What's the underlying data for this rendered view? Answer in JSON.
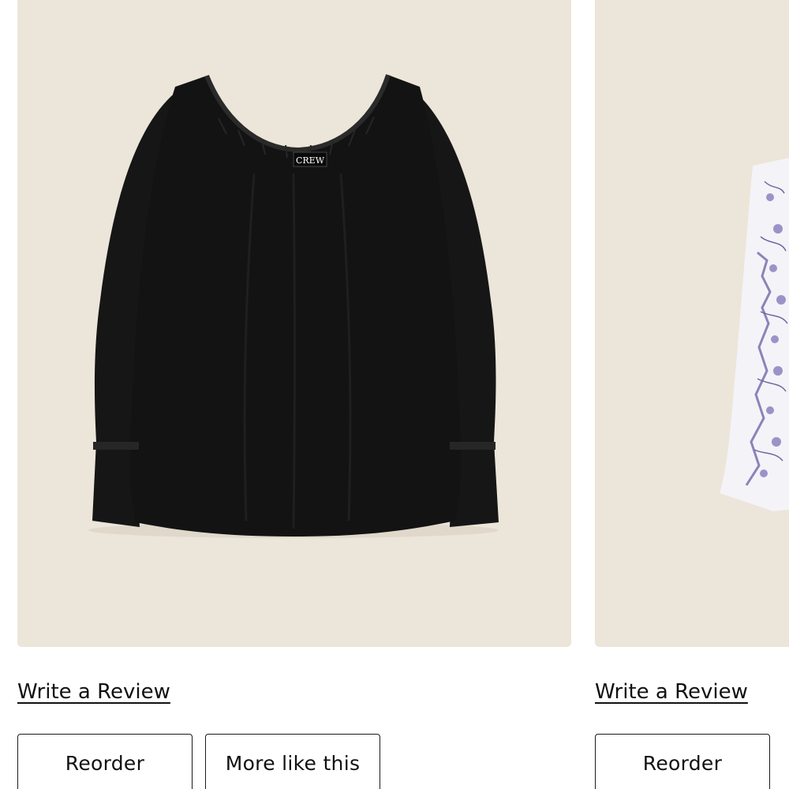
{
  "products": [
    {
      "image_alt": "black blouse",
      "label_text": "CREW",
      "write_review_label": "Write a Review",
      "reorder_label": "Reorder",
      "more_like_this_label": "More like this",
      "colors": {
        "background": "#ece5d9",
        "garment": "#141414"
      }
    },
    {
      "image_alt": "printed top",
      "write_review_label": "Write a Review",
      "reorder_label": "Reorder",
      "colors": {
        "background": "#ece5d9",
        "print_base": "#f4f3f8",
        "print_accent": "#8a84b8"
      }
    }
  ]
}
